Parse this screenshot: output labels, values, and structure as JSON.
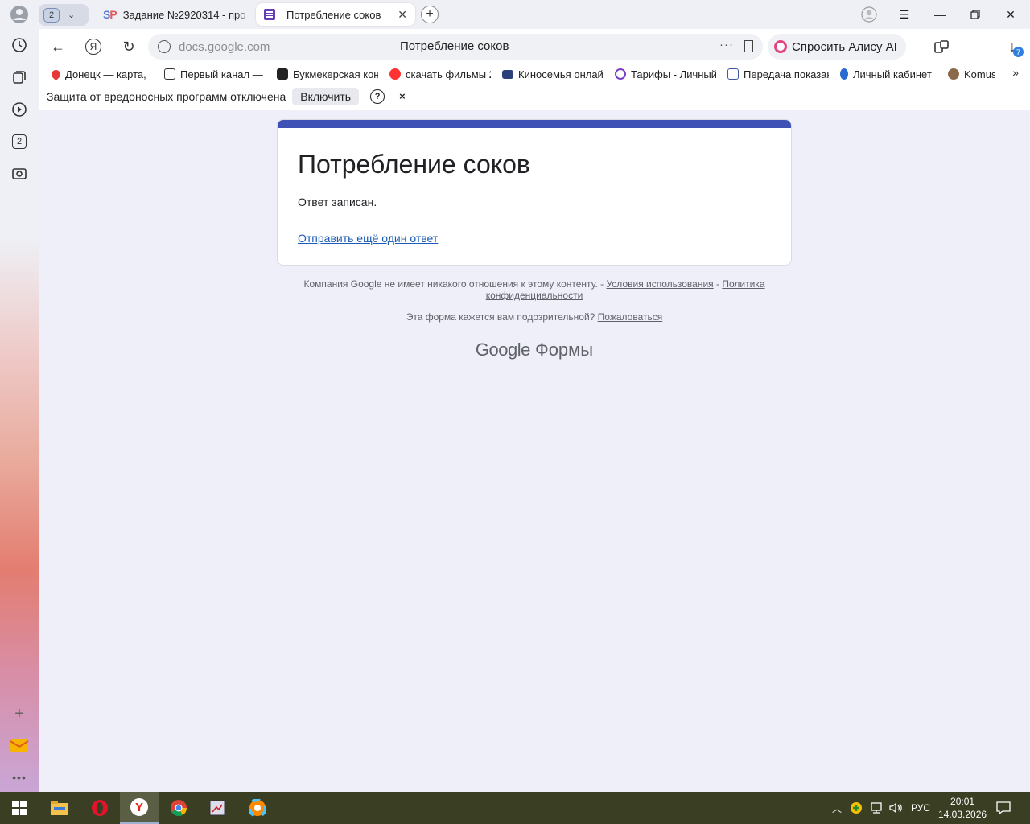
{
  "browser": {
    "tab_group_count": "2",
    "tabs": [
      {
        "title": "Задание №2920314 - про"
      },
      {
        "title": "Потребление соков"
      }
    ],
    "address": {
      "url": "docs.google.com",
      "page_title": "Потребление соков",
      "menu_dots": "···"
    },
    "alice_label": "Спросить Алису AI",
    "downloads_badge": "7",
    "sidebar_tab_count": "2",
    "bookmarks": [
      {
        "label": "Донецк — карта, с"
      },
      {
        "label": "Первый канал — с"
      },
      {
        "label": "Букмекерская кон"
      },
      {
        "label": "скачать фильмы 2"
      },
      {
        "label": "Киносемья онлай"
      },
      {
        "label": "Тарифы - Личный"
      },
      {
        "label": "Передача показан"
      },
      {
        "label": "Личный кабинет"
      },
      {
        "label": "Komus"
      }
    ],
    "infobar": {
      "text": "Защита от вредоносных программ отключена",
      "button": "Включить",
      "help": "?",
      "close": "×"
    }
  },
  "form": {
    "title": "Потребление соков",
    "message": "Ответ записан.",
    "again_link": "Отправить ещё один ответ",
    "accent": "#3f51b5"
  },
  "footer": {
    "note_text": "Компания Google не имеет никакого отношения к этому контенту. - ",
    "terms_link": "Условия использования",
    "sep": " - ",
    "privacy_link": "Политика конфиденциальности",
    "report_text": "Эта форма кажется вам подозрительной? ",
    "report_link": "Пожаловаться",
    "logo_google": "Google",
    "logo_forms": "Формы"
  },
  "taskbar": {
    "language": "РУС",
    "time": "20:01",
    "date": "14.03.2026"
  }
}
